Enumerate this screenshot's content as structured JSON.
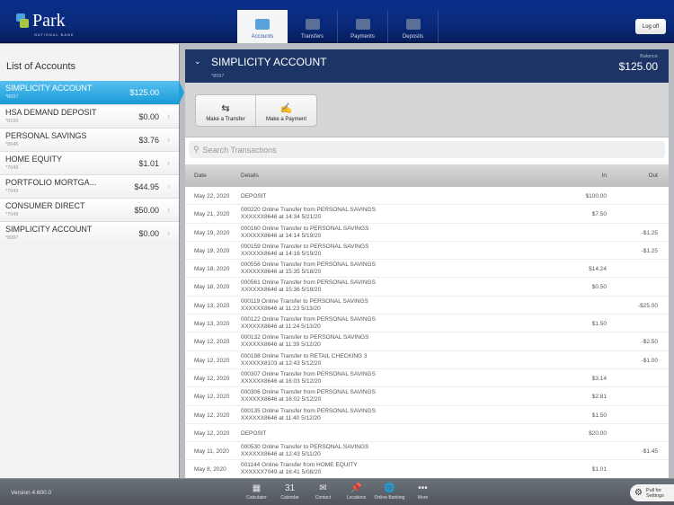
{
  "brand": {
    "name": "Park",
    "sub": "NATIONAL BANK"
  },
  "tabs": [
    {
      "label": "Accounts",
      "active": true
    },
    {
      "label": "Transfers"
    },
    {
      "label": "Payments"
    },
    {
      "label": "Deposits"
    }
  ],
  "logoff_label": "Log off",
  "sidebar": {
    "title": "List of Accounts",
    "accounts": [
      {
        "name": "SIMPLICITY ACCOUNT",
        "number": "*8097",
        "balance": "$125.00",
        "selected": true
      },
      {
        "name": "HSA DEMAND DEPOSIT",
        "number": "*8100",
        "balance": "$0.00"
      },
      {
        "name": "PERSONAL SAVINGS",
        "number": "*8646",
        "balance": "$3.76"
      },
      {
        "name": "HOME EQUITY",
        "number": "*7049",
        "balance": "$1.01"
      },
      {
        "name": "PORTFOLIO MORTGA...",
        "number": "*7049",
        "balance": "$44.95"
      },
      {
        "name": "CONSUMER DIRECT",
        "number": "*7049",
        "balance": "$50.00"
      },
      {
        "name": "SIMPLICITY ACCOUNT",
        "number": "*8097",
        "balance": "$0.00"
      }
    ]
  },
  "account": {
    "title": "SIMPLICITY ACCOUNT",
    "number": "*8097",
    "balance_label": "Balance",
    "balance": "$125.00"
  },
  "actions": {
    "transfer": "Make a Transfer",
    "payment": "Make a Payment"
  },
  "search": {
    "placeholder": "Search Transactions"
  },
  "table": {
    "headers": {
      "date": "Date",
      "details": "Details",
      "in": "In",
      "out": "Out"
    },
    "rows": [
      {
        "date": "May 22, 2020",
        "l1": "DEPOSIT",
        "l2": "",
        "in": "$100.00",
        "out": ""
      },
      {
        "date": "May 21, 2020",
        "l1": "000220 Online Transfer from PERSONAL SAVINGS",
        "l2": "XXXXXX8646 at 14:34 5/21/20",
        "in": "$7.50",
        "out": ""
      },
      {
        "date": "May 19, 2020",
        "l1": "000160 Online Transfer to PERSONAL SAVINGS",
        "l2": "XXXXXX8646 at 14:14 5/19/20",
        "in": "",
        "out": "-$1.25"
      },
      {
        "date": "May 19, 2020",
        "l1": "000159 Online Transfer to PERSONAL SAVINGS",
        "l2": "XXXXXX8646 at 14:16 5/19/20",
        "in": "",
        "out": "-$1.25"
      },
      {
        "date": "May 18, 2020",
        "l1": "000556 Online Transfer from PERSONAL SAVINGS",
        "l2": "XXXXXX8646 at 15:35 5/18/20",
        "in": "$14.24",
        "out": ""
      },
      {
        "date": "May 18, 2020",
        "l1": "000561 Online Transfer from PERSONAL SAVINGS",
        "l2": "XXXXXX8646 at 15:36 5/18/20",
        "in": "$0.50",
        "out": ""
      },
      {
        "date": "May 13, 2020",
        "l1": "000119 Online Transfer to PERSONAL SAVINGS",
        "l2": "XXXXXX8646 at 11:23 5/13/20",
        "in": "",
        "out": "-$25.00"
      },
      {
        "date": "May 13, 2020",
        "l1": "000122 Online Transfer from PERSONAL SAVINGS",
        "l2": "XXXXXX8646 at 11:24 5/13/20",
        "in": "$1.50",
        "out": ""
      },
      {
        "date": "May 12, 2020",
        "l1": "000132 Online Transfer to PERSONAL SAVINGS",
        "l2": "XXXXXX8646 at 11:39 5/12/20",
        "in": "",
        "out": "-$2.50"
      },
      {
        "date": "May 12, 2020",
        "l1": "000198 Online Transfer to RETAIL CHECKING 3",
        "l2": "XXXXXX8103 at 12:43 5/12/20",
        "in": "",
        "out": "-$1.00"
      },
      {
        "date": "May 12, 2020",
        "l1": "000307 Online Transfer from PERSONAL SAVINGS",
        "l2": "XXXXXX8646 at 16:03 5/12/20",
        "in": "$3.14",
        "out": ""
      },
      {
        "date": "May 12, 2020",
        "l1": "000306 Online Transfer from PERSONAL SAVINGS",
        "l2": "XXXXXX8646 at 16:02 5/12/20",
        "in": "$2.81",
        "out": ""
      },
      {
        "date": "May 12, 2020",
        "l1": "000135 Online Transfer from PERSONAL SAVINGS",
        "l2": "XXXXXX8646 at 11:40 5/12/20",
        "in": "$1.50",
        "out": ""
      },
      {
        "date": "May 12, 2020",
        "l1": "DEPOSIT",
        "l2": "",
        "in": "$20.00",
        "out": ""
      },
      {
        "date": "May 11, 2020",
        "l1": "000530 Online Transfer to PERSONAL SAVINGS",
        "l2": "XXXXXX8646 at 12:43 5/11/20",
        "in": "",
        "out": "-$1.45"
      },
      {
        "date": "May 8, 2020",
        "l1": "001144 Online Transfer from HOME EQUITY",
        "l2": "XXXXXX7049 at 16:41 5/08/20",
        "in": "$1.01",
        "out": ""
      }
    ]
  },
  "footer": {
    "version": "Version 4.600.0",
    "tools": [
      {
        "label": "Calculator",
        "icon": "calculator-icon",
        "glyph": "▦"
      },
      {
        "label": "Calendar",
        "icon": "calendar-icon",
        "glyph": "31"
      },
      {
        "label": "Contact",
        "icon": "envelope-icon",
        "glyph": "✉"
      },
      {
        "label": "Locations",
        "icon": "pin-icon",
        "glyph": "📌"
      },
      {
        "label": "Online Banking",
        "icon": "globe-icon",
        "glyph": "🌐"
      },
      {
        "label": "More",
        "icon": "more-icon",
        "glyph": "•••"
      }
    ],
    "pull1": "Pull for",
    "pull2": "Settings"
  }
}
